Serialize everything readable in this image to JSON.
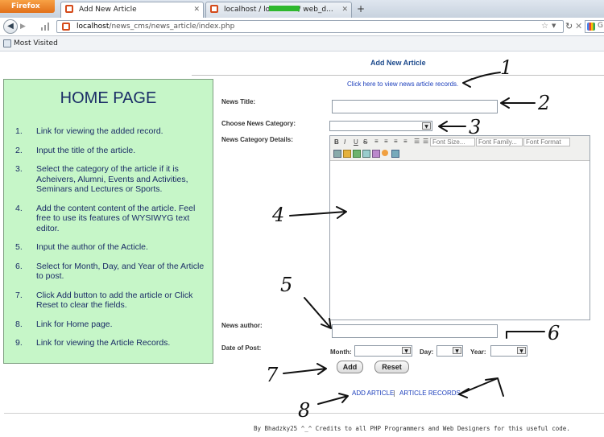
{
  "browser": {
    "menu_button": "Firefox",
    "tabs": [
      {
        "title": "Add New Article"
      },
      {
        "title": "localhost / localhost /              web_d..."
      }
    ],
    "new_tab": "+",
    "url_host": "localhost",
    "url_path": "/news_cms/news_article/index.php",
    "bookmarks": [
      "Most Visited"
    ],
    "search_hint": "G"
  },
  "page": {
    "heading": "Add New Article",
    "view_records_link": "Click here to view news article records.",
    "form": {
      "news_title_label": "News Title:",
      "news_title_value": "",
      "category_label": "Choose News Category:",
      "category_value": "",
      "details_label": "News Category Details:",
      "editor_toolbar": {
        "font_size": "Font Size...",
        "font_family": "Font Family...",
        "font_format": "Font Format"
      },
      "author_label": "News author:",
      "author_value": "",
      "date_label": "Date of Post:",
      "month_label": "Month:",
      "day_label": "Day:",
      "year_label": "Year:",
      "add_button": "Add",
      "reset_button": "Reset"
    },
    "footer_links": {
      "add_article": "ADD ARTICLE",
      "separator": "|",
      "article_records": "ARTICLE RECORDS"
    },
    "credits": "By Bhadzky25 ^_^ Credits to all PHP Programmers and Web Designers for this useful code."
  },
  "sidebar": {
    "title": "HOME PAGE",
    "items": [
      {
        "num": "1.",
        "text": "Link for viewing the added record."
      },
      {
        "num": "2.",
        "text": "Input the title of the article."
      },
      {
        "num": "3.",
        "text": "Select the category of the article if it is Acheivers, Alumni, Events and Activities, Seminars and Lectures or Sports."
      },
      {
        "num": "4.",
        "text": "Add the content content of the article. Feel free to use its features of WYSIWYG text editor."
      },
      {
        "num": "5.",
        "text": "Input the author of the Acticle."
      },
      {
        "num": "6.",
        "text": "Select for Month, Day, and Year of the Article to post."
      },
      {
        "num": "7.",
        "text": "Click Add button to add the article or Click Reset to clear the fields."
      },
      {
        "num": "8.",
        "text": "Link for Home page."
      },
      {
        "num": "9.",
        "text": "Link for viewing the Article Records."
      }
    ]
  },
  "annotations": [
    "1",
    "2",
    "3",
    "4",
    "5",
    "6",
    "7",
    "8"
  ]
}
